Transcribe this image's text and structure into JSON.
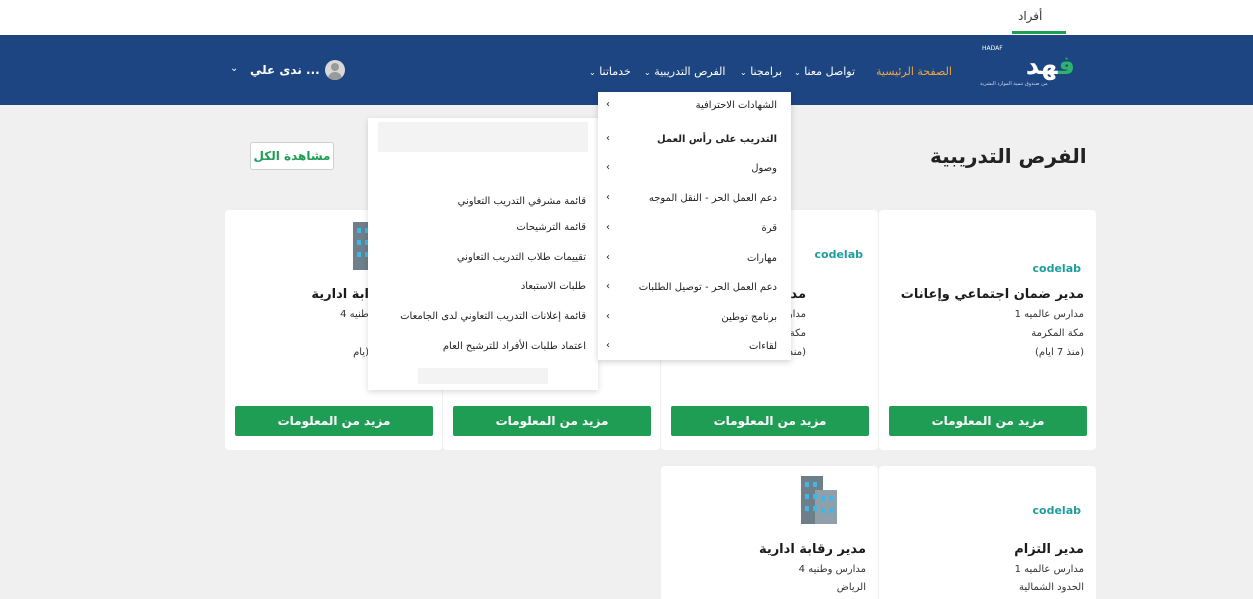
{
  "top": {
    "individuals_tab": "أفراد"
  },
  "logo": {
    "top_text": "HADAF",
    "word_a": "هد",
    "word_b": "ف",
    "subtitle": "من صندوق تنمية الموارد البشرية"
  },
  "nav": {
    "home": "الصفحة الرئيسية",
    "contact": "تواصل معنا",
    "programs": "برامجنا",
    "training": "الفرص التدريبية",
    "services": "خدماتنا",
    "chevron": "⌄"
  },
  "user": {
    "name": "ندى علي ...",
    "chevron": "⌄"
  },
  "main": {
    "title": "الفرص التدريبية",
    "view_all": "مشاهدة الكل"
  },
  "cards": [
    {
      "logo": "codelab",
      "title": "مدير ضمان اجتماعي وإعانات",
      "company": "مدارس عالميه 1",
      "city": "مكة المكرمة",
      "time": "(منذ 7 ايام)",
      "button": "مزيد من المعلومات"
    },
    {
      "logo": "codelab",
      "title": "مدير ضمان",
      "company": "مدارس عالم",
      "city": "مكة المكرم",
      "time": "(منذ 7 ايام)",
      "button": "مزيد من المعلومات"
    },
    {
      "title": "",
      "company": "",
      "city": "",
      "time": "",
      "button": "مزيد من المعلومات"
    },
    {
      "title": "ابة ادارية",
      "company": "طنيه 4",
      "city": "",
      "time": "يام)",
      "button": "مزيد من المعلومات"
    },
    {
      "logo": "codelab",
      "title": "مدير التزام",
      "company": "مدارس عالميه 1",
      "city": "الحدود الشمالية"
    },
    {
      "title": "مدير رقابة ادارية",
      "company": "مدارس وطنيه 4",
      "city": "الرياض"
    }
  ],
  "dropdown": {
    "arrow": "‹",
    "items": [
      "الشهادات الاحترافية",
      "التدريب على رأس العمل",
      "وصول",
      "دعم العمل الحر - النقل الموجه",
      "قرة",
      "مهارات",
      "دعم العمل الحر - توصيل الطلبات",
      "برنامج توطين",
      "لقاءات"
    ]
  },
  "submenu": {
    "items": [
      "قائمة مشرفي التدريب التعاوني",
      "قائمة الترشيحات",
      "تقييمات طلاب التدريب التعاوني",
      "طلبات الاستبعاد",
      "قائمة إعلانات التدريب التعاوني لدى الجامعات",
      "اعتماد طلبات الأفراد للترشيح العام"
    ]
  },
  "colors": {
    "navbar": "#1c4582",
    "accent_green": "#1f9d55",
    "active_nav": "#f0a640",
    "building_window": "#3bb7e8"
  }
}
